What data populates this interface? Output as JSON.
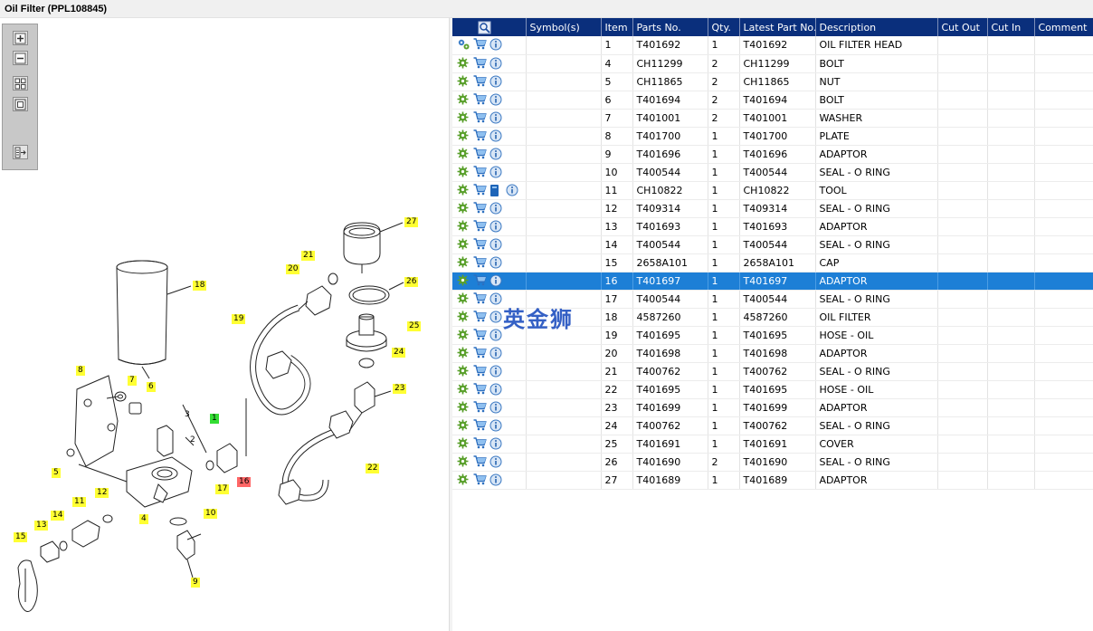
{
  "window": {
    "title": "Oil Filter (PPL108845)"
  },
  "toolbar": {
    "buttons": [
      {
        "name": "zoom-in"
      },
      {
        "name": "zoom-out"
      },
      {
        "name": "fit-all"
      },
      {
        "name": "fit-window"
      },
      {
        "name": "list-view"
      }
    ]
  },
  "watermark": "英金狮",
  "table": {
    "headers": [
      "",
      "Symbol(s)",
      "Item",
      "Parts No.",
      "Qty.",
      "Latest Part No.",
      "Description",
      "Cut Out",
      "Cut In",
      "Comment"
    ],
    "selected_item": "16",
    "rows": [
      {
        "item": "1",
        "part": "T401692",
        "qty": "1",
        "latest": "T401692",
        "desc": "OIL FILTER HEAD",
        "icons": [
          "gear-multi",
          "cart",
          "info"
        ]
      },
      {
        "item": "4",
        "part": "CH11299",
        "qty": "2",
        "latest": "CH11299",
        "desc": "BOLT",
        "icons": [
          "gear",
          "cart",
          "info"
        ]
      },
      {
        "item": "5",
        "part": "CH11865",
        "qty": "2",
        "latest": "CH11865",
        "desc": "NUT",
        "icons": [
          "gear",
          "cart",
          "info"
        ]
      },
      {
        "item": "6",
        "part": "T401694",
        "qty": "2",
        "latest": "T401694",
        "desc": "BOLT",
        "icons": [
          "gear",
          "cart",
          "info"
        ]
      },
      {
        "item": "7",
        "part": "T401001",
        "qty": "2",
        "latest": "T401001",
        "desc": "WASHER",
        "icons": [
          "gear",
          "cart",
          "info"
        ]
      },
      {
        "item": "8",
        "part": "T401700",
        "qty": "1",
        "latest": "T401700",
        "desc": "PLATE",
        "icons": [
          "gear",
          "cart",
          "info"
        ]
      },
      {
        "item": "9",
        "part": "T401696",
        "qty": "1",
        "latest": "T401696",
        "desc": "ADAPTOR",
        "icons": [
          "gear",
          "cart",
          "info"
        ]
      },
      {
        "item": "10",
        "part": "T400544",
        "qty": "1",
        "latest": "T400544",
        "desc": "SEAL - O RING",
        "icons": [
          "gear",
          "cart",
          "info"
        ]
      },
      {
        "item": "11",
        "part": "CH10822",
        "qty": "1",
        "latest": "CH10822",
        "desc": "TOOL",
        "icons": [
          "gear",
          "cart",
          "book",
          "info"
        ]
      },
      {
        "item": "12",
        "part": "T409314",
        "qty": "1",
        "latest": "T409314",
        "desc": "SEAL - O RING",
        "icons": [
          "gear",
          "cart",
          "info"
        ]
      },
      {
        "item": "13",
        "part": "T401693",
        "qty": "1",
        "latest": "T401693",
        "desc": "ADAPTOR",
        "icons": [
          "gear",
          "cart",
          "info"
        ]
      },
      {
        "item": "14",
        "part": "T400544",
        "qty": "1",
        "latest": "T400544",
        "desc": "SEAL - O RING",
        "icons": [
          "gear",
          "cart",
          "info"
        ]
      },
      {
        "item": "15",
        "part": "2658A101",
        "qty": "1",
        "latest": "2658A101",
        "desc": "CAP",
        "icons": [
          "gear",
          "cart",
          "info"
        ]
      },
      {
        "item": "16",
        "part": "T401697",
        "qty": "1",
        "latest": "T401697",
        "desc": "ADAPTOR",
        "icons": [
          "gear",
          "cart",
          "info"
        ]
      },
      {
        "item": "17",
        "part": "T400544",
        "qty": "1",
        "latest": "T400544",
        "desc": "SEAL - O RING",
        "icons": [
          "gear",
          "cart",
          "info"
        ]
      },
      {
        "item": "18",
        "part": "4587260",
        "qty": "1",
        "latest": "4587260",
        "desc": "OIL FILTER",
        "icons": [
          "gear",
          "cart",
          "info"
        ]
      },
      {
        "item": "19",
        "part": "T401695",
        "qty": "1",
        "latest": "T401695",
        "desc": "HOSE - OIL",
        "icons": [
          "gear",
          "cart",
          "info"
        ]
      },
      {
        "item": "20",
        "part": "T401698",
        "qty": "1",
        "latest": "T401698",
        "desc": "ADAPTOR",
        "icons": [
          "gear",
          "cart",
          "info"
        ]
      },
      {
        "item": "21",
        "part": "T400762",
        "qty": "1",
        "latest": "T400762",
        "desc": "SEAL - O RING",
        "icons": [
          "gear",
          "cart",
          "info"
        ]
      },
      {
        "item": "22",
        "part": "T401695",
        "qty": "1",
        "latest": "T401695",
        "desc": "HOSE - OIL",
        "icons": [
          "gear",
          "cart",
          "info"
        ]
      },
      {
        "item": "23",
        "part": "T401699",
        "qty": "1",
        "latest": "T401699",
        "desc": "ADAPTOR",
        "icons": [
          "gear",
          "cart",
          "info"
        ]
      },
      {
        "item": "24",
        "part": "T400762",
        "qty": "1",
        "latest": "T400762",
        "desc": "SEAL - O RING",
        "icons": [
          "gear",
          "cart",
          "info"
        ]
      },
      {
        "item": "25",
        "part": "T401691",
        "qty": "1",
        "latest": "T401691",
        "desc": "COVER",
        "icons": [
          "gear",
          "cart",
          "info"
        ]
      },
      {
        "item": "26",
        "part": "T401690",
        "qty": "2",
        "latest": "T401690",
        "desc": "SEAL - O RING",
        "icons": [
          "gear",
          "cart",
          "info"
        ]
      },
      {
        "item": "27",
        "part": "T401689",
        "qty": "1",
        "latest": "T401689",
        "desc": "ADAPTOR",
        "icons": [
          "gear",
          "cart",
          "info"
        ]
      }
    ]
  },
  "callouts": [
    {
      "n": "1",
      "style": "green"
    },
    {
      "n": "2",
      "style": "plain"
    },
    {
      "n": "3",
      "style": "plain"
    },
    {
      "n": "4",
      "style": "yellow"
    },
    {
      "n": "5",
      "style": "yellow"
    },
    {
      "n": "6",
      "style": "yellow"
    },
    {
      "n": "7",
      "style": "yellow"
    },
    {
      "n": "8",
      "style": "yellow"
    },
    {
      "n": "9",
      "style": "yellow"
    },
    {
      "n": "10",
      "style": "yellow"
    },
    {
      "n": "11",
      "style": "yellow"
    },
    {
      "n": "12",
      "style": "yellow"
    },
    {
      "n": "13",
      "style": "yellow"
    },
    {
      "n": "14",
      "style": "yellow"
    },
    {
      "n": "15",
      "style": "yellow"
    },
    {
      "n": "16",
      "style": "red"
    },
    {
      "n": "17",
      "style": "yellow"
    },
    {
      "n": "18",
      "style": "yellow"
    },
    {
      "n": "19",
      "style": "yellow"
    },
    {
      "n": "20",
      "style": "yellow"
    },
    {
      "n": "21",
      "style": "yellow"
    },
    {
      "n": "22",
      "style": "yellow"
    },
    {
      "n": "23",
      "style": "yellow"
    },
    {
      "n": "24",
      "style": "yellow"
    },
    {
      "n": "25",
      "style": "yellow"
    },
    {
      "n": "26",
      "style": "yellow"
    },
    {
      "n": "27",
      "style": "yellow"
    }
  ],
  "colors": {
    "header_bg": "#0a2f7c",
    "selected_row": "#1d7fd6",
    "callout_yellow": "#ffff33",
    "callout_green": "#33dd33",
    "callout_red": "#ff6666"
  }
}
